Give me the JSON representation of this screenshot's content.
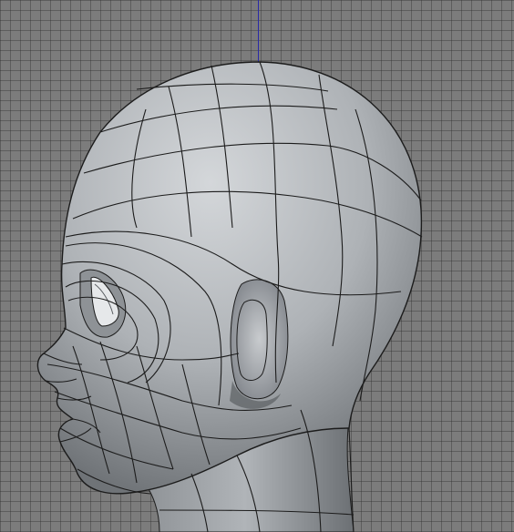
{
  "viewport": {
    "name": "side-orthographic-viewport",
    "background_color": "#7c7c7c",
    "grid_color": "#3c3c3c",
    "axis_color": "#2a2aa8"
  },
  "model": {
    "name": "head-base-mesh",
    "view": "side",
    "shading": "smooth-shaded-with-wireframe",
    "surface_color": "#b4b8bc",
    "wire_color": "#1c1c1c"
  }
}
